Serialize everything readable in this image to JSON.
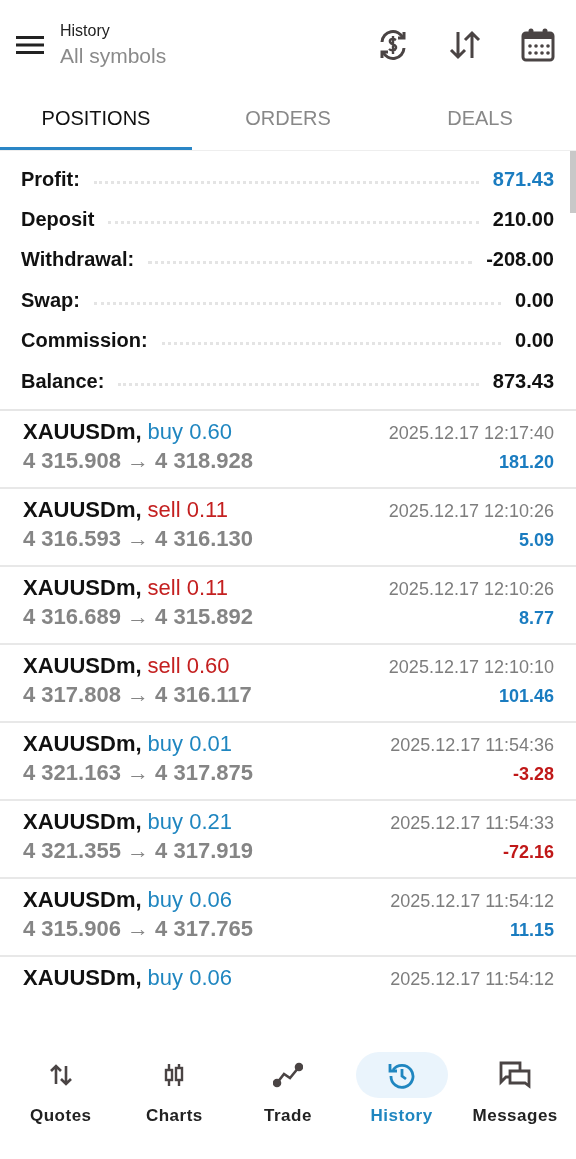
{
  "header": {
    "title": "History",
    "subtitle": "All symbols"
  },
  "tabs": [
    {
      "label": "POSITIONS",
      "selected": true
    },
    {
      "label": "ORDERS",
      "selected": false
    },
    {
      "label": "DEALS",
      "selected": false
    }
  ],
  "summary": [
    {
      "label": "Profit:",
      "value": "871.43",
      "highlight": true
    },
    {
      "label": "Deposit",
      "value": "210.00",
      "highlight": false
    },
    {
      "label": "Withdrawal:",
      "value": "-208.00",
      "highlight": false
    },
    {
      "label": "Swap:",
      "value": "0.00",
      "highlight": false
    },
    {
      "label": "Commission:",
      "value": "0.00",
      "highlight": false
    },
    {
      "label": "Balance:",
      "value": "873.43",
      "highlight": false
    }
  ],
  "positions": [
    {
      "symbol": "XAUUSDm,",
      "type": "buy",
      "volume": "0.60",
      "prices": "4 315.908 → 4 318.928",
      "time": "2025.12.17 12:17:40",
      "profit": "181.20",
      "negative": false
    },
    {
      "symbol": "XAUUSDm,",
      "type": "sell",
      "volume": "0.11",
      "prices": "4 316.593 → 4 316.130",
      "time": "2025.12.17 12:10:26",
      "profit": "5.09",
      "negative": false
    },
    {
      "symbol": "XAUUSDm,",
      "type": "sell",
      "volume": "0.11",
      "prices": "4 316.689 → 4 315.892",
      "time": "2025.12.17 12:10:26",
      "profit": "8.77",
      "negative": false
    },
    {
      "symbol": "XAUUSDm,",
      "type": "sell",
      "volume": "0.60",
      "prices": "4 317.808 → 4 316.117",
      "time": "2025.12.17 12:10:10",
      "profit": "101.46",
      "negative": false
    },
    {
      "symbol": "XAUUSDm,",
      "type": "buy",
      "volume": "0.01",
      "prices": "4 321.163 → 4 317.875",
      "time": "2025.12.17 11:54:36",
      "profit": "-3.28",
      "negative": true
    },
    {
      "symbol": "XAUUSDm,",
      "type": "buy",
      "volume": "0.21",
      "prices": "4 321.355 → 4 317.919",
      "time": "2025.12.17 11:54:33",
      "profit": "-72.16",
      "negative": true
    },
    {
      "symbol": "XAUUSDm,",
      "type": "buy",
      "volume": "0.06",
      "prices": "4 315.906 → 4 317.765",
      "time": "2025.12.17 11:54:12",
      "profit": "11.15",
      "negative": false
    },
    {
      "symbol": "XAUUSDm,",
      "type": "buy",
      "volume": "0.06",
      "time": "2025.12.17 11:54:12"
    }
  ],
  "nav": [
    {
      "label": "Quotes",
      "kind": "quotes",
      "selected": false
    },
    {
      "label": "Charts",
      "kind": "charts",
      "selected": false
    },
    {
      "label": "Trade",
      "kind": "trade",
      "selected": false
    },
    {
      "label": "History",
      "kind": "history",
      "selected": true
    },
    {
      "label": "Messages",
      "kind": "messages",
      "selected": false
    }
  ]
}
